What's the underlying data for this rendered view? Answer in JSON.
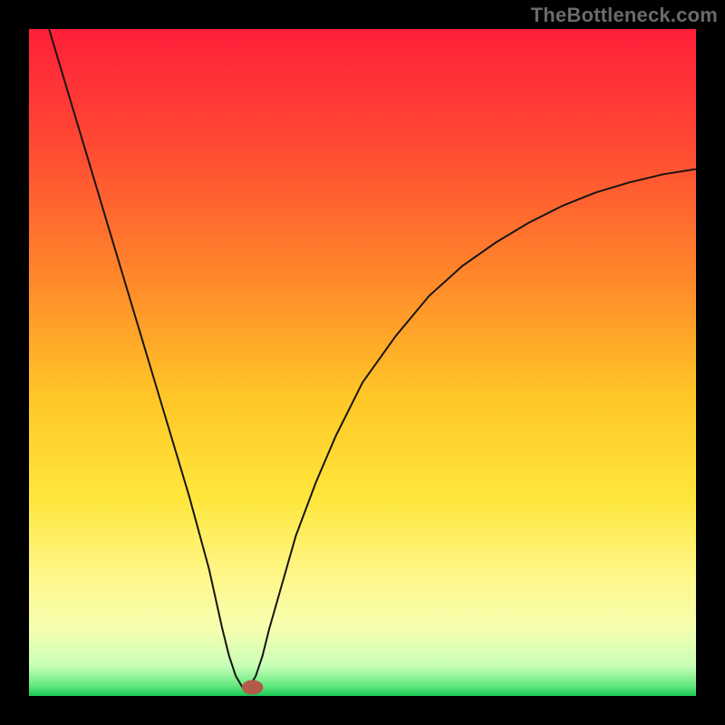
{
  "watermark": "TheBottleneck.com",
  "chart_data": {
    "type": "line",
    "title": "",
    "xlabel": "",
    "ylabel": "",
    "xlim": [
      0,
      100
    ],
    "ylim": [
      0,
      100
    ],
    "curve_note": "Values estimated from pixel positions; y is percent of plot height from bottom (0=bottom, 100=top). Curve shows a sharp V-notch near x≈32 then recovers.",
    "x": [
      3,
      6,
      9,
      12,
      15,
      18,
      21,
      24,
      27,
      29,
      30,
      31,
      32,
      33,
      34,
      35,
      36,
      38,
      40,
      43,
      46,
      50,
      55,
      60,
      65,
      70,
      75,
      80,
      85,
      90,
      95,
      100
    ],
    "y": [
      100,
      90,
      80,
      70,
      60,
      50,
      40,
      30,
      19,
      10,
      6,
      3,
      1.3,
      1.3,
      3,
      6,
      10,
      17,
      24,
      32,
      39,
      47,
      54,
      60,
      64.5,
      68,
      71,
      73.5,
      75.5,
      77,
      78.2,
      79
    ],
    "marker": {
      "x": 33.5,
      "y": 1.3,
      "color": "#b35a4a",
      "rx": 1.6,
      "ry": 1.1
    },
    "gradient_stops": [
      {
        "offset": 0.0,
        "color": "#ff1f3a"
      },
      {
        "offset": 0.18,
        "color": "#ff4b33"
      },
      {
        "offset": 0.38,
        "color": "#ff8a2a"
      },
      {
        "offset": 0.55,
        "color": "#ffc627"
      },
      {
        "offset": 0.7,
        "color": "#ffe63a"
      },
      {
        "offset": 0.82,
        "color": "#fff78a"
      },
      {
        "offset": 0.9,
        "color": "#f6ffb0"
      },
      {
        "offset": 0.955,
        "color": "#c8ffb8"
      },
      {
        "offset": 0.985,
        "color": "#62e87e"
      },
      {
        "offset": 1.0,
        "color": "#19c554"
      }
    ],
    "curve_stroke": "#171512",
    "curve_width": 2
  }
}
